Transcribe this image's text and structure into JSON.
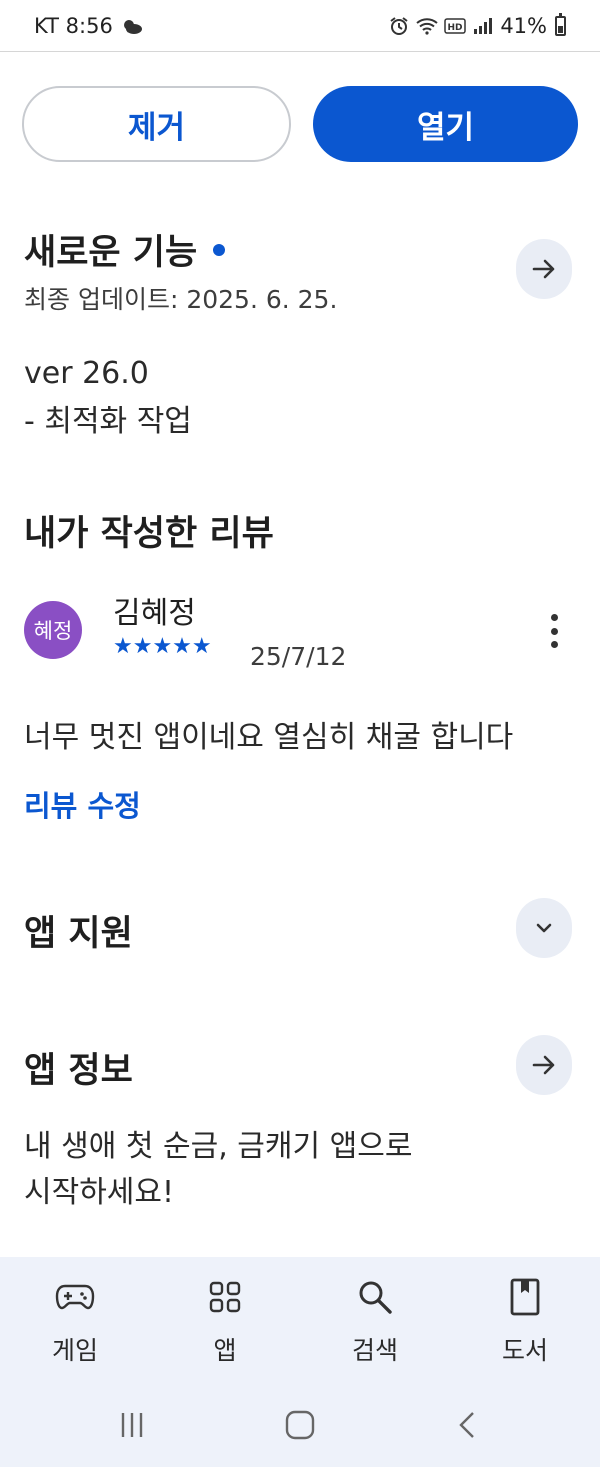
{
  "status_bar": {
    "carrier_time": "KT 8:56",
    "battery": "41%",
    "battery_level": 0.41
  },
  "actions": {
    "remove_label": "제거",
    "open_label": "열기"
  },
  "whats_new": {
    "title": "새로운 기능",
    "last_updated": "최종 업데이트: 2025. 6. 25.",
    "version": "ver 26.0",
    "note": "- 최적화 작업"
  },
  "my_review": {
    "title": "내가 작성한 리뷰",
    "avatar_text": "혜정",
    "reviewer": "김혜정",
    "rating": 5,
    "stars": "★★★★★",
    "date": "25/7/12",
    "text": "너무 멋진 앱이네요 열심히 채굴 합니다",
    "edit_label": "리뷰 수정"
  },
  "app_support": {
    "title": "앱 지원"
  },
  "app_info": {
    "title": "앱 정보",
    "description_line1": "내 생애 첫 순금, 금캐기 앱으로",
    "description_line2": "시작하세요!"
  },
  "bottom_nav": {
    "items": [
      {
        "label": "게임",
        "icon": "gamepad-icon"
      },
      {
        "label": "앱",
        "icon": "apps-grid-icon"
      },
      {
        "label": "검색",
        "icon": "search-icon"
      },
      {
        "label": "도서",
        "icon": "book-icon"
      }
    ]
  },
  "colors": {
    "accent": "#0b57d0",
    "avatar": "#8a4fc4",
    "nav_bg": "#eef2fa",
    "circle_btn_bg": "#e9edf5"
  }
}
